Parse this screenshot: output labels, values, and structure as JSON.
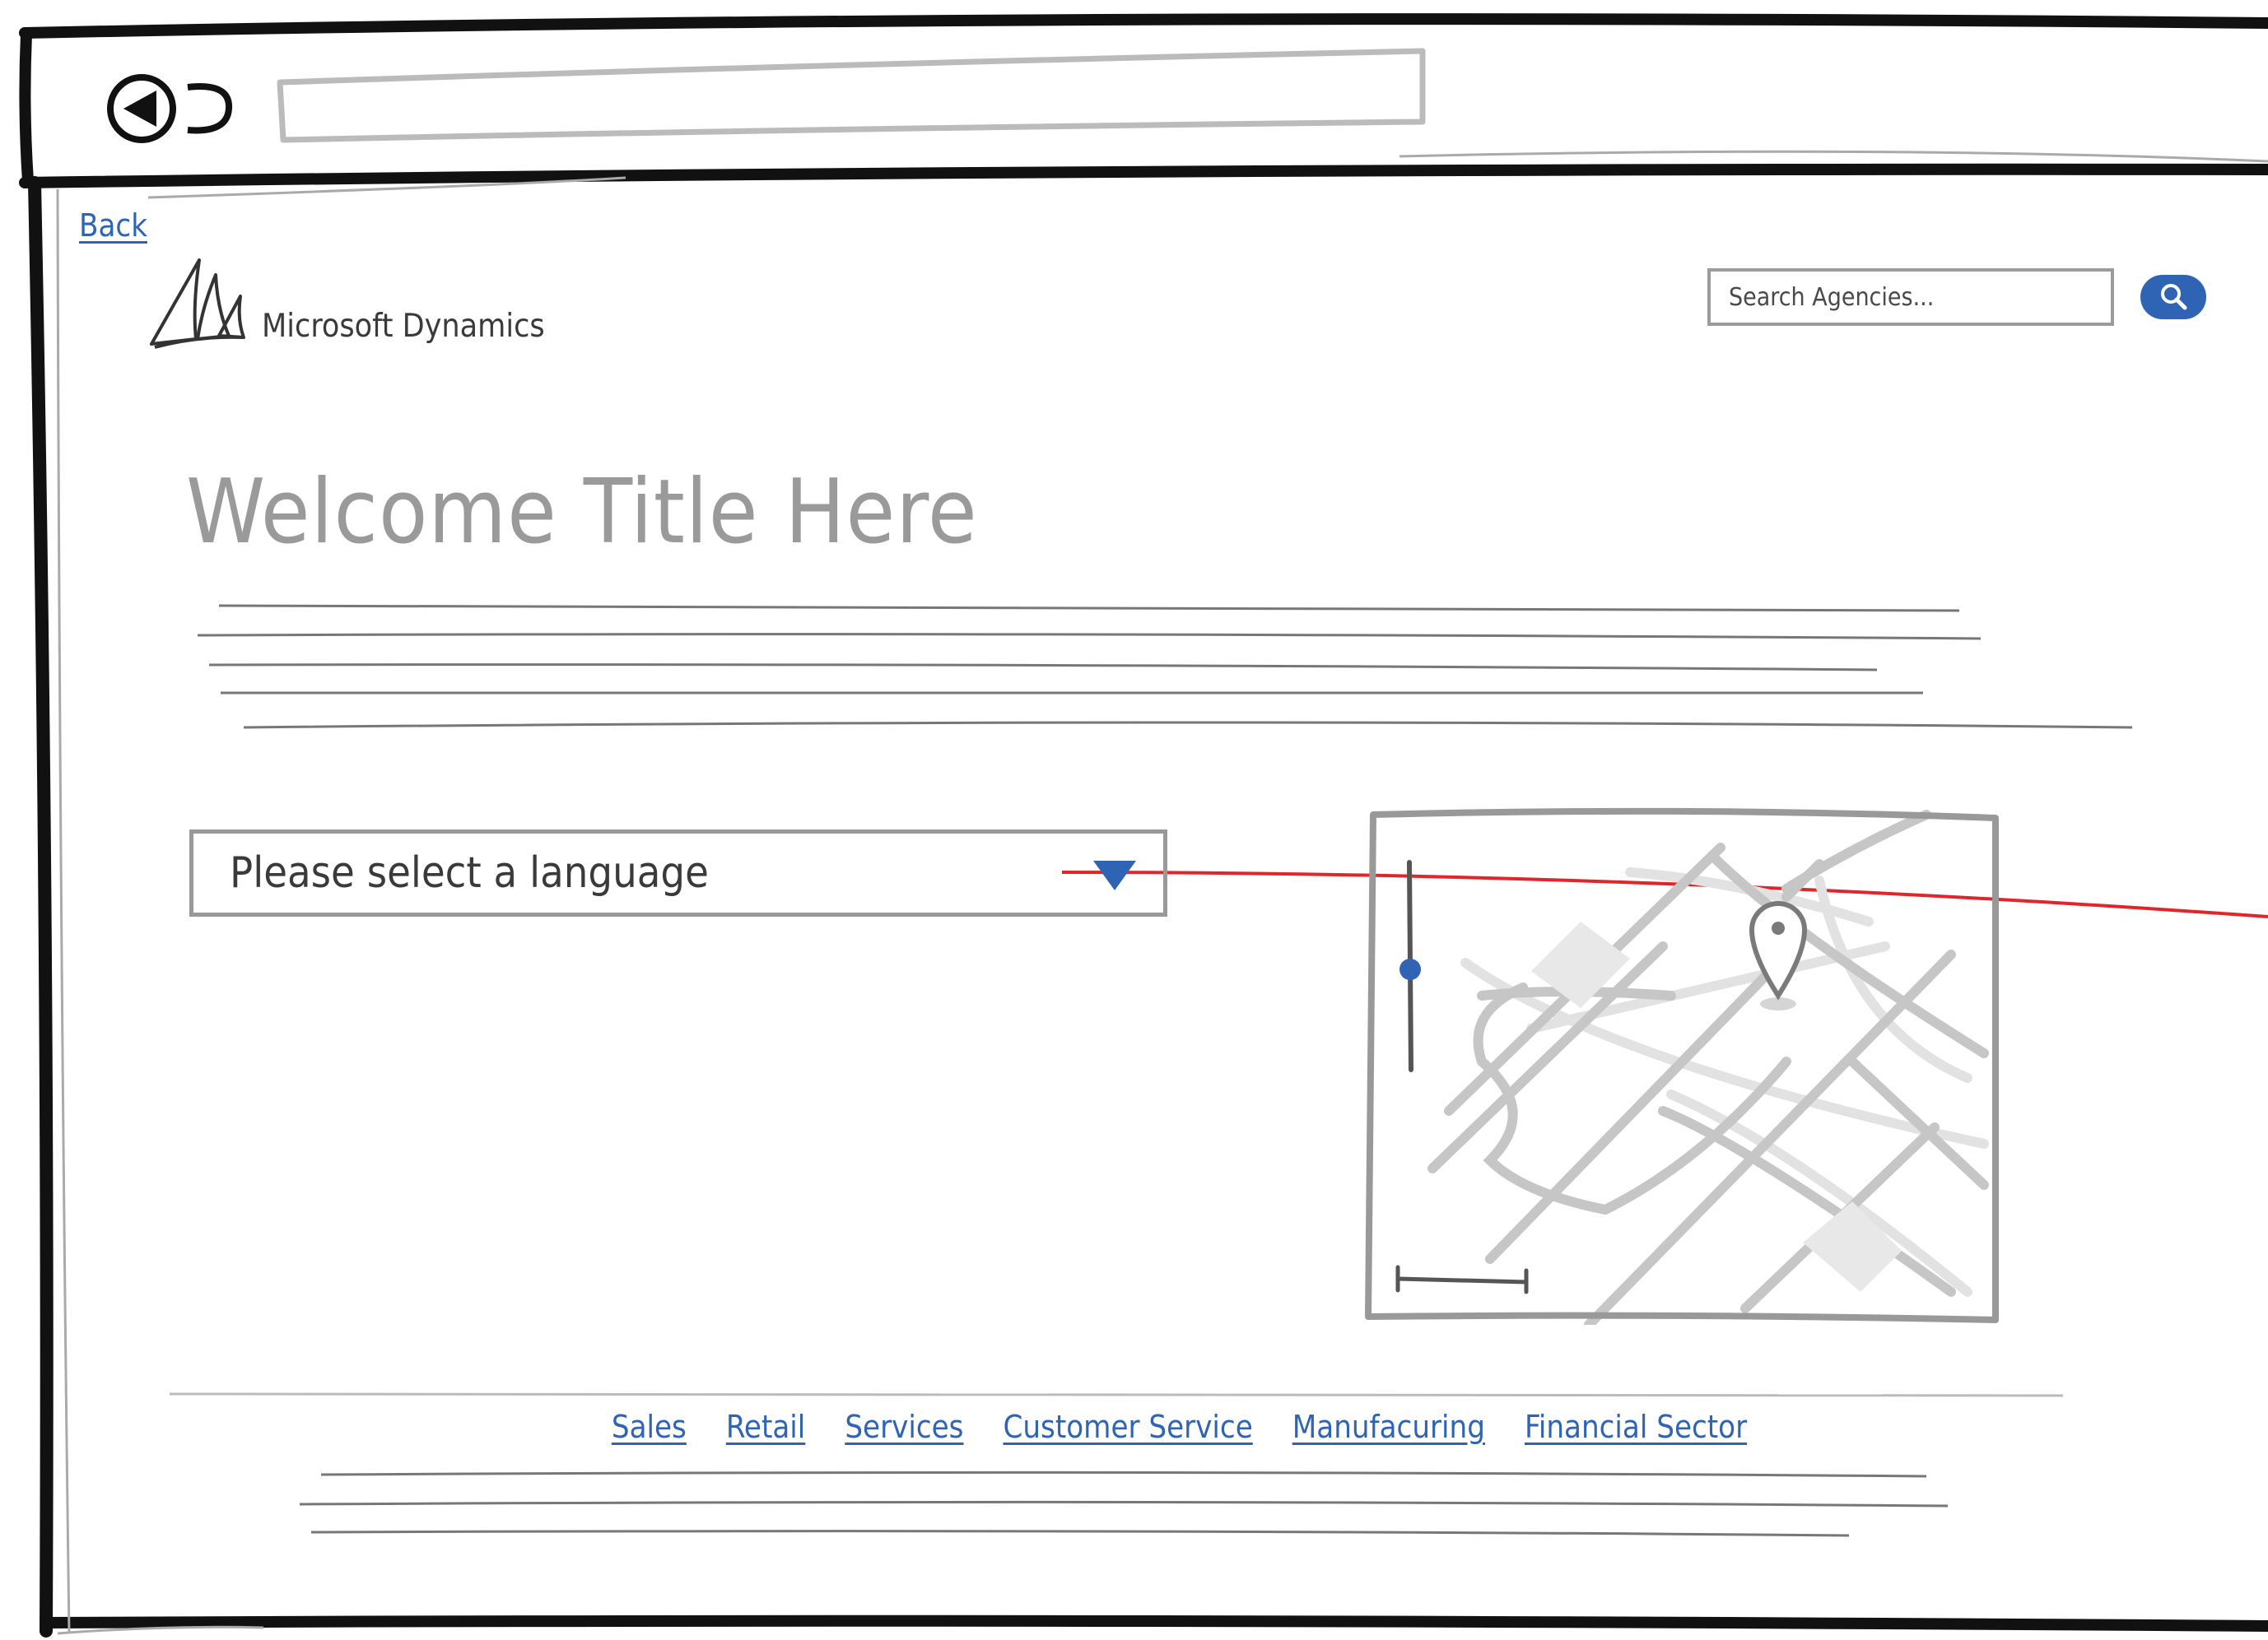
{
  "navigation": {
    "back_label": "Back"
  },
  "brand": {
    "name": "Microsoft Dynamics",
    "logo_icon": "sail-logo-icon"
  },
  "search": {
    "placeholder": "Search Agencies...",
    "button_icon": "search-icon"
  },
  "main": {
    "title": "Welcome Title Here"
  },
  "language_select": {
    "selected": "Please select a language",
    "arrow_icon": "chevron-down-icon"
  },
  "footer": {
    "links": [
      {
        "label": "Sales"
      },
      {
        "label": "Retail"
      },
      {
        "label": "Services"
      },
      {
        "label": "Customer Service"
      },
      {
        "label": "Manufacuring"
      },
      {
        "label": "Financial Sector"
      }
    ]
  },
  "colors": {
    "accent": "#2f64b5",
    "annotation": "#e0262b",
    "sketch_gray": "#9a9a9a",
    "frame": "#111111"
  }
}
